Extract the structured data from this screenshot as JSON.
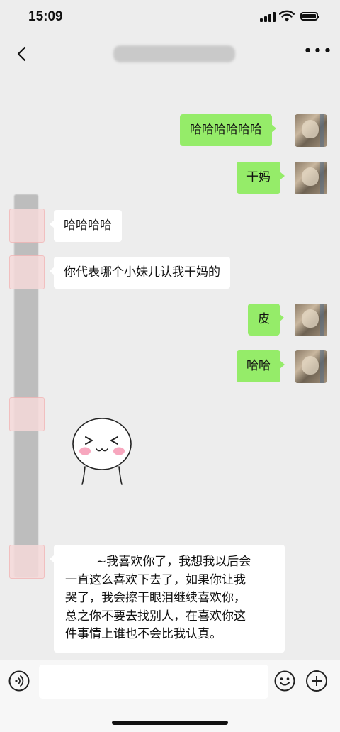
{
  "status_bar": {
    "time": "15:09",
    "icons": [
      "signal-icon",
      "wifi-icon",
      "battery-icon"
    ]
  },
  "nav": {
    "back_icon": "chevron-left-icon",
    "title": "",
    "more_icon": "more-dots-icon"
  },
  "messages": [
    {
      "side": "me",
      "text": "哈哈哈哈哈哈"
    },
    {
      "side": "me",
      "text": "干妈"
    },
    {
      "side": "other",
      "text": "哈哈哈哈"
    },
    {
      "side": "other",
      "text": "你代表哪个小妹儿认我干妈的"
    },
    {
      "side": "me",
      "text": "皮"
    },
    {
      "side": "me",
      "text": "哈哈"
    },
    {
      "side": "other",
      "sticker": "blushing-face-sticker"
    },
    {
      "side": "other",
      "lines": [
        "~我喜欢你了，我想我以后会",
        "一直这么喜欢下去了，如果你让我",
        "哭了，我会擦干眼泪继续喜欢你，",
        "总之你不要去找别人，在喜欢你这",
        "件事情上谁也不会比我认真。"
      ]
    }
  ],
  "input_bar": {
    "placeholder": "",
    "icons": [
      "voice-icon",
      "emoji-icon",
      "plus-icon"
    ]
  },
  "colors": {
    "background": "#ededed",
    "my_bubble": "#95ec69",
    "other_bubble": "#ffffff"
  }
}
